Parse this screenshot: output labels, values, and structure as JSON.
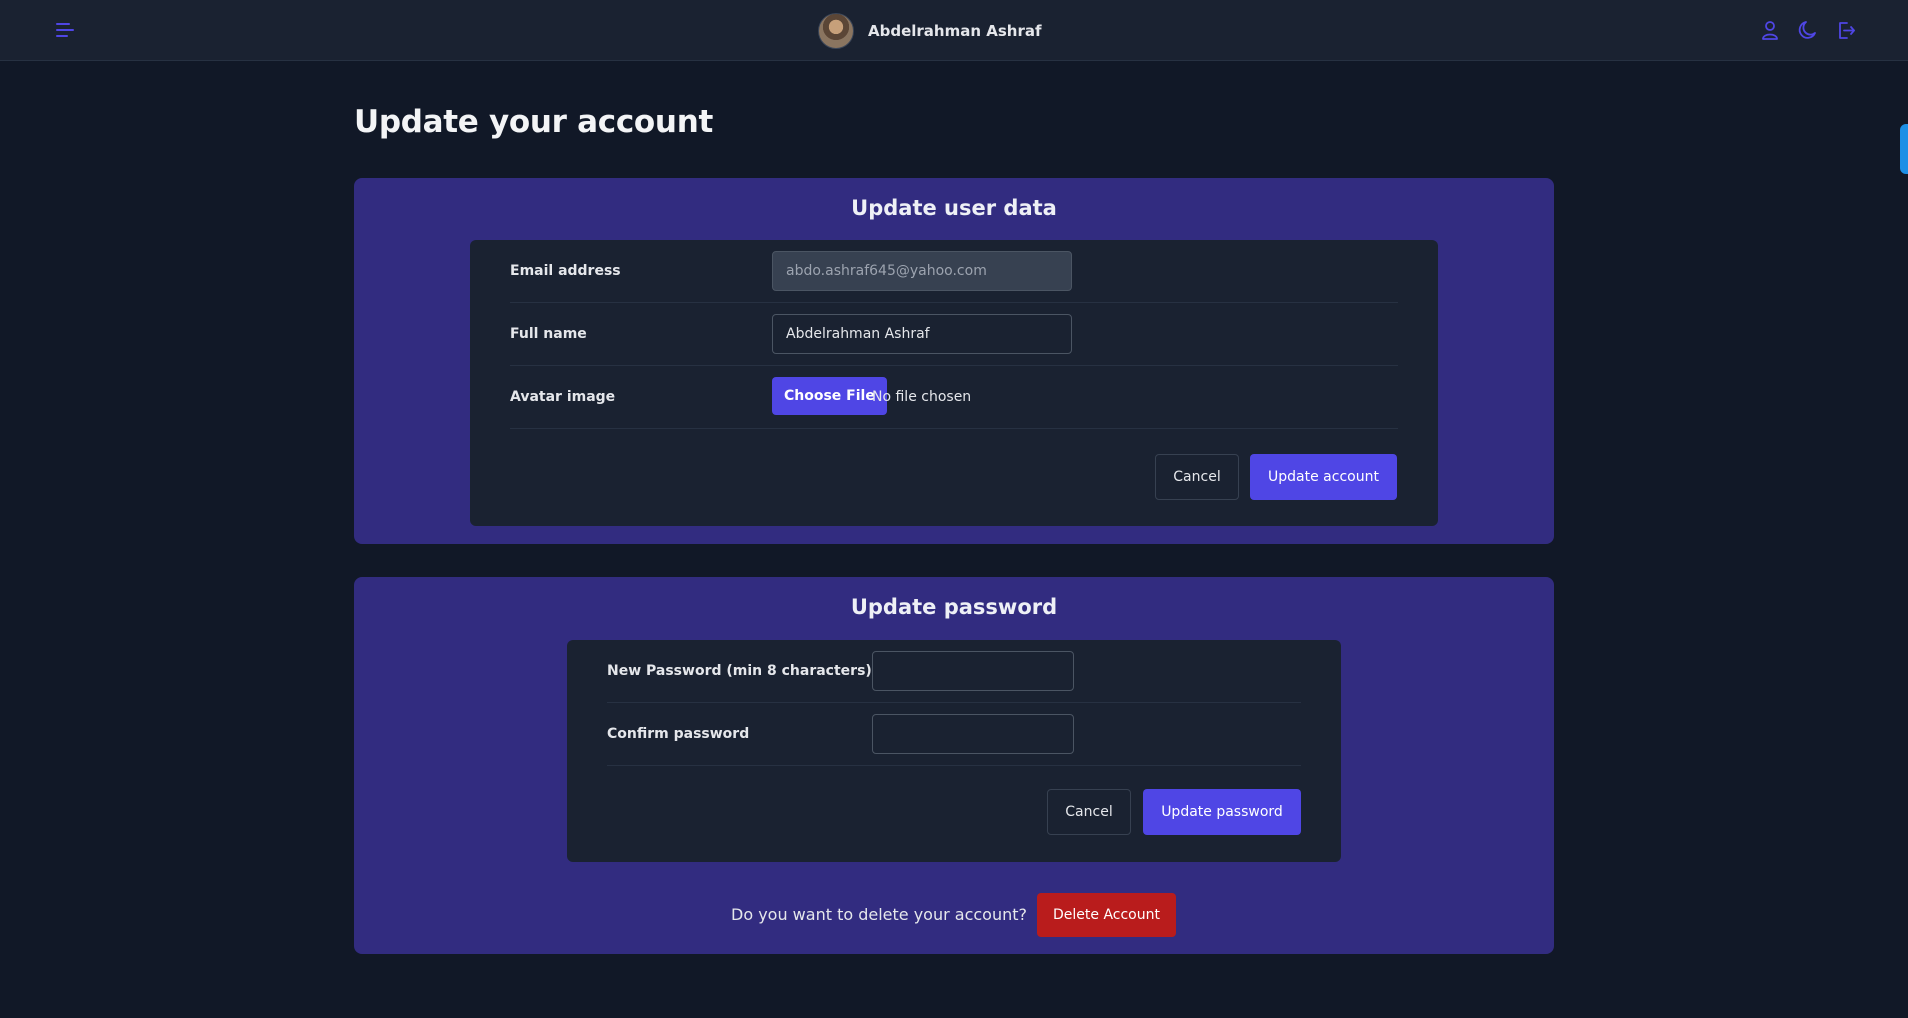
{
  "header": {
    "user_name": "Abdelrahman Ashraf",
    "menu_icon": "menu-icon",
    "icons": [
      "user-icon",
      "moon-icon",
      "logout-icon"
    ],
    "accent_color": "#4f46e5"
  },
  "page": {
    "title": "Update your account"
  },
  "user_data_card": {
    "title": "Update user data",
    "email_label": "Email address",
    "email_value": "abdo.ashraf645@yahoo.com",
    "fullname_label": "Full name",
    "fullname_value": "Abdelrahman Ashraf",
    "avatar_label": "Avatar image",
    "choose_file_label": "Choose File",
    "file_status": "No file chosen",
    "cancel_label": "Cancel",
    "submit_label": "Update account"
  },
  "password_card": {
    "title": "Update password",
    "new_password_label": "New Password (min 8 characters)",
    "new_password_value": "",
    "confirm_label": "Confirm password",
    "confirm_value": "",
    "cancel_label": "Cancel",
    "submit_label": "Update password",
    "delete_prompt": "Do you want to delete your account?",
    "delete_label": "Delete Account"
  },
  "colors": {
    "background": "#111827",
    "card": "#322c80",
    "panel": "#1a2231",
    "primary": "#4f46e5",
    "danger": "#b91c1c"
  }
}
